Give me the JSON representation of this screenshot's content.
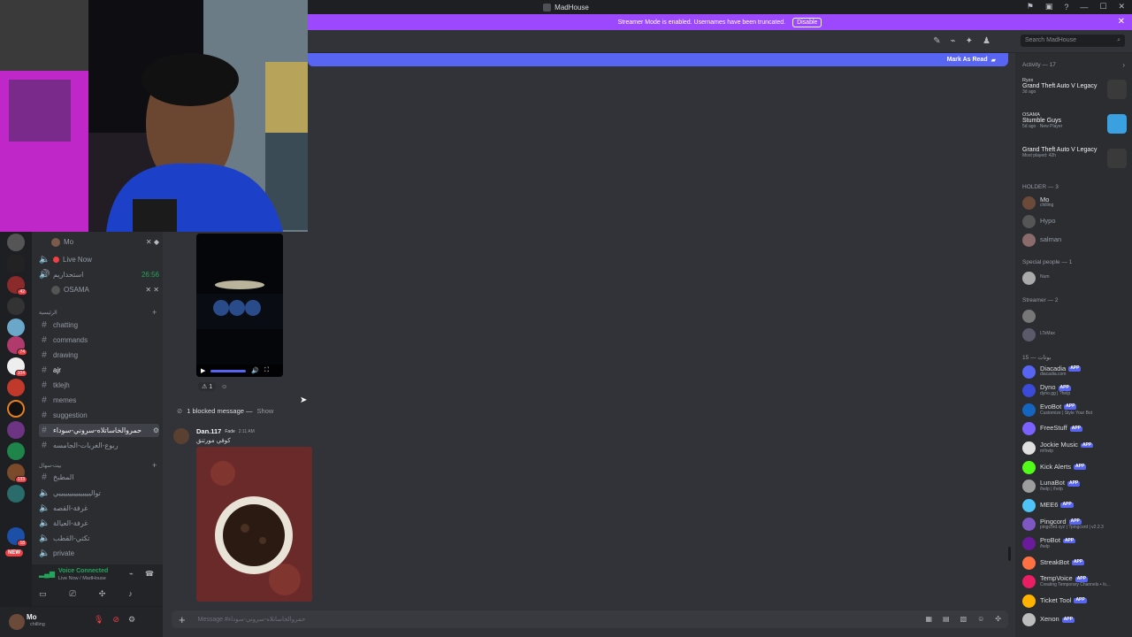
{
  "window": {
    "title": "MadHouse",
    "controls": [
      "—",
      "☐",
      "✕"
    ]
  },
  "banner": {
    "text": "Streamer Mode is enabled. Usernames have been truncated.",
    "button": "Disable"
  },
  "header": {
    "search_placeholder": "Search MadHouse"
  },
  "new_messages": {
    "label": "Mark As Read"
  },
  "servers": {
    "badges": [
      "42",
      "74",
      "104",
      "133",
      "18"
    ],
    "new_label": "NEW"
  },
  "channels": {
    "voice_users": [
      {
        "name": "Mo"
      },
      {
        "name": "OSAMA"
      }
    ],
    "live_now": "Live Now",
    "voice_channel_name": "ﺍﺳﺘﺤﺪﺍﺭﻳﻢ",
    "voice_timer": "26:56",
    "category1": "ﺍﻟﺮﺋﻴﺴﻴﺔ",
    "text_channels": [
      "chatting",
      "commands",
      "drawing",
      "ajr",
      "tklejh",
      "memes",
      "suggestion"
    ],
    "active_channel": "ﺣﻤﺮﻭﺍﻟﺨﺎﺳﺎﺗﻼﻩ-ﺳﺮﻭﻧﻲ-ﺳﻮﺩﺍء",
    "other_channel": "ﺭﺑﻮﻉ-ﺍﻟﻐﺮﺑﺎﺕ-ﺍﻟﺠﺎﻣﺴﻪ",
    "category2": "ﺑﻴﺖ-ﺳﻬﺎﻝ",
    "category2_channels": [
      "ﺍﻟﻤﻄﺒﺦ",
      "ﺗﻮﺍﻟﻴﻴﻴﻴﻴﻴﻴﻴﻴﻴﻴﻴﻴﻴﻴﻲ",
      "ﻏﺮﻓﺔ-ﺍﻟﻘﺼﻪ",
      "ﻏﺮﻓﺔ-ﺍﻟﻌﻴﺎﻟﺔ",
      "ﺗﻜﺘﻲ-ﺍﻟﻘﻄﺐ"
    ],
    "private_channel": "private"
  },
  "voice_panel": {
    "status": "Voice Connected",
    "location": "Live Now / MadHouse"
  },
  "user_panel": {
    "name": "Mo",
    "status": "chilling"
  },
  "chat": {
    "reaction_count": "1",
    "blocked_text": "1 blocked message —",
    "blocked_show": "Show",
    "author": "Dan.117",
    "author_tag": "Fade",
    "time": "2:11 AM",
    "message": "ﻛﻮﻓﻲ ﻣﻮﺭﺗﻨﻖ",
    "input_placeholder": "Message #ﺣﻤﺮﻭﺍﻟﺨﺎﺳﺎﺗﻼﻩ-ﺳﺮﻭﻧﻲ-ﺳﻮﺩﺍء"
  },
  "members": {
    "activity_header": "Activity — 17",
    "activities": [
      {
        "user": "Ryzx",
        "game": "Grand Theft Auto V Legacy",
        "sub": "3d ago"
      },
      {
        "user": "OSAMA",
        "game": "Stumble Guys",
        "sub": "5d ago · New Player"
      },
      {
        "user": "",
        "game": "Grand Theft Auto V Legacy",
        "sub": "Most played: 42h"
      }
    ],
    "holder_header": "HOLDER — 3",
    "holders": [
      {
        "name": "Mo",
        "sub": "chilling"
      },
      {
        "name": "Hypo",
        "sub": ""
      },
      {
        "name": "salman",
        "sub": ""
      }
    ],
    "special_header": "Special people — 1",
    "special": [
      {
        "name": "",
        "sub": "Num"
      }
    ],
    "streamer_header": "Streamer — 2",
    "streamers": [
      {
        "name": "",
        "sub": ""
      },
      {
        "name": "",
        "sub": "LTsMax"
      }
    ],
    "bots_header": "15 — ﺑﻮﺗﺎﺕ",
    "app_badge": "APP",
    "bots": [
      {
        "name": "Diacadia",
        "sub": "diacadia.com",
        "color": "#5865f2"
      },
      {
        "name": "Dyno",
        "sub": "dyno.gg | ?help",
        "color": "#3b4bd8"
      },
      {
        "name": "EvoBot",
        "sub": "Customize | Style Your Bot",
        "color": "#1565c0"
      },
      {
        "name": "FreeStuff",
        "sub": "",
        "color": "#7b61ff"
      },
      {
        "name": "Jockie Music",
        "sub": "m!help",
        "color": "#e0e0e0"
      },
      {
        "name": "Kick Alerts",
        "sub": "",
        "color": "#53fc18"
      },
      {
        "name": "LunaBot",
        "sub": "/help | /help",
        "color": "#9e9e9e"
      },
      {
        "name": "MEE6",
        "sub": "",
        "color": "#4fc3f7"
      },
      {
        "name": "Pingcord",
        "sub": "pingcord.xyz | ?pingcord | v2.2.3",
        "color": "#7e57c2"
      },
      {
        "name": "ProBot",
        "sub": "/help",
        "color": "#6a1b9a"
      },
      {
        "name": "StreakBot",
        "sub": "",
        "color": "#ff7043"
      },
      {
        "name": "TempVoice",
        "sub": "Creating Temporary Channels • /s...",
        "color": "#e91e63"
      },
      {
        "name": "Ticket Tool",
        "sub": "",
        "color": "#ffb300"
      },
      {
        "name": "Xenon",
        "sub": "",
        "color": "#bdbdbd"
      }
    ]
  }
}
